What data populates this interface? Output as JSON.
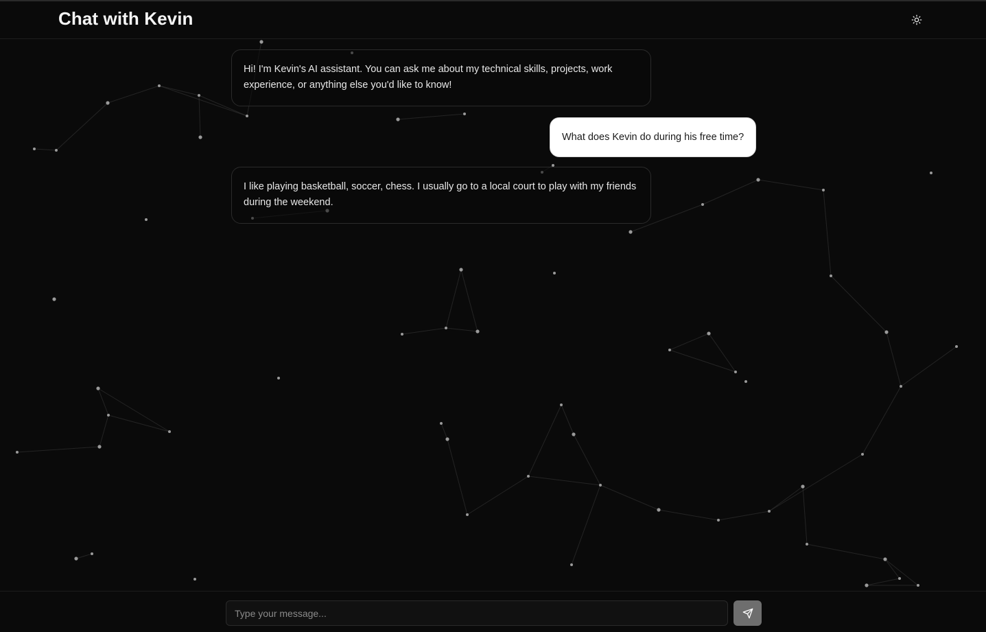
{
  "header": {
    "title": "Chat with Kevin",
    "theme_toggle_icon": "sun-icon"
  },
  "messages": [
    {
      "role": "assistant",
      "text": "Hi! I'm Kevin's AI assistant. You can ask me about my technical skills, projects, work experience, or anything else you'd like to know!"
    },
    {
      "role": "user",
      "text": "What does Kevin do during his free time?"
    },
    {
      "role": "assistant",
      "text": "I like playing basketball, soccer, chess. I usually go to a local court to play with my friends during the weekend."
    }
  ],
  "composer": {
    "placeholder": "Type your message...",
    "value": "",
    "send_icon": "send-icon"
  },
  "colors": {
    "background": "#0a0a0a",
    "user_bubble": "#ffffff",
    "send_button": "#6e6e6e",
    "particles": "#9a9a9a"
  }
}
